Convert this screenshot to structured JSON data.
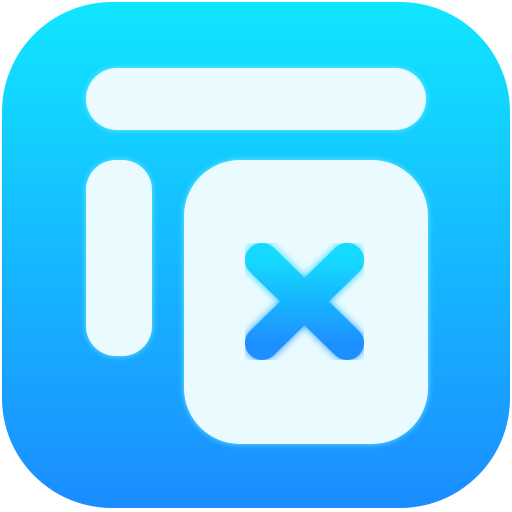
{
  "icon": {
    "name": "window-close-app-icon",
    "glyph": "close-icon",
    "colors": {
      "background_top": "#10e6ff",
      "background_bottom": "#1b8cff",
      "panel_fill": "#e9fbff",
      "panel_glow": "#8ef3ff",
      "cross_top": "#12d9ff",
      "cross_bottom": "#1e90ff"
    }
  }
}
